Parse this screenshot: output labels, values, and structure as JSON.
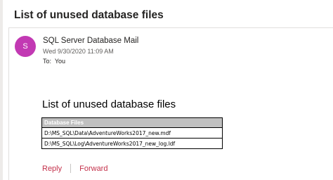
{
  "message": {
    "subject": "List of unused database files",
    "avatar_initial": "S",
    "sender": "SQL Server Database Mail",
    "date": "Wed 9/30/2020 11:09 AM",
    "to_label": "To:",
    "to_value": "You"
  },
  "body": {
    "title": "List of unused database files",
    "table": {
      "header": "Database Files",
      "rows": [
        "D:\\MS_SQL\\Data\\AdventureWorks2017_new.mdf",
        "D:\\MS_SQL\\Log\\AdventureWorks2017_new_log.ldf"
      ]
    }
  },
  "actions": {
    "reply_label": "Reply",
    "forward_label": "Forward"
  },
  "colors": {
    "avatar": "#c239b3",
    "action_link": "#c4314b",
    "table_header_bg": "#c0c0c0"
  }
}
